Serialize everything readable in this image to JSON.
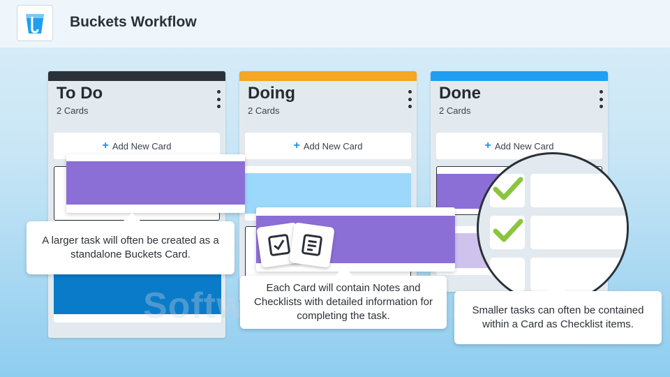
{
  "header": {
    "title": "Buckets Workflow",
    "logo_icon": "bucket-logo-icon"
  },
  "columns": [
    {
      "title": "To Do",
      "count": "2 Cards",
      "accent": "#2b3138",
      "add_label": "Add New Card"
    },
    {
      "title": "Doing",
      "count": "2 Cards",
      "accent": "#f5a623",
      "add_label": "Add New Card"
    },
    {
      "title": "Done",
      "count": "2 Cards",
      "accent": "#1e9ff2",
      "add_label": "Add New Card"
    }
  ],
  "card_colors": {
    "purple": "#8c6fd6",
    "light_blue": "#9bd8fb",
    "blue": "#0a7bc9",
    "light_purple": "#cfc3ee"
  },
  "callouts": {
    "standalone": "A larger task will often be created as a standalone Buckets Card.",
    "notes": "Each Card will contain Notes and Checklists with detailed information for completing the task.",
    "checklist": "Smaller tasks can often be contained within a Card as Checklist items."
  },
  "icons": {
    "checklist": "checkbox-icon",
    "notes": "notes-icon",
    "check": "green-check-icon"
  },
  "accent_check": "#8bc53f",
  "watermark": "SoftwareSuggest.com"
}
